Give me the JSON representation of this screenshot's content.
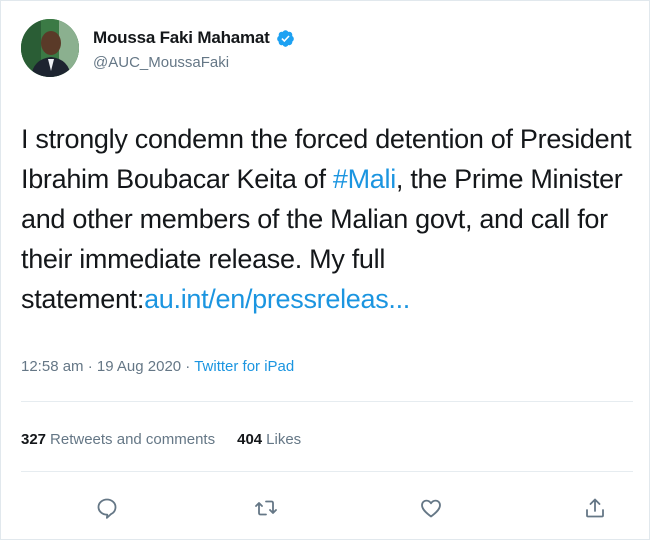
{
  "author": {
    "display_name": "Moussa Faki Mahamat",
    "handle": "@AUC_MoussaFaki",
    "verified": true
  },
  "tweet": {
    "text_before": "I strongly condemn the forced detention of President Ibrahim Boubacar Keita of ",
    "hashtag": "#Mali",
    "text_after": ", the Prime Minister and other members of the Malian govt,  and call for their immediate release. My full statement:",
    "link": "au.int/en/pressreleas..."
  },
  "meta": {
    "timestamp": "12:58 am · 19 Aug 2020 · ",
    "source": "Twitter for iPad"
  },
  "stats": {
    "retweets_count": "327",
    "retweets_label": "Retweets and comments",
    "likes_count": "404",
    "likes_label": "Likes"
  },
  "icons": {
    "reply": "reply-icon",
    "retweet": "retweet-icon",
    "like": "like-icon",
    "share": "share-icon"
  },
  "colors": {
    "link": "#1b95e0",
    "secondary_text": "#657786",
    "primary_text": "#14171a",
    "verified_badge": "#1da1f2"
  }
}
